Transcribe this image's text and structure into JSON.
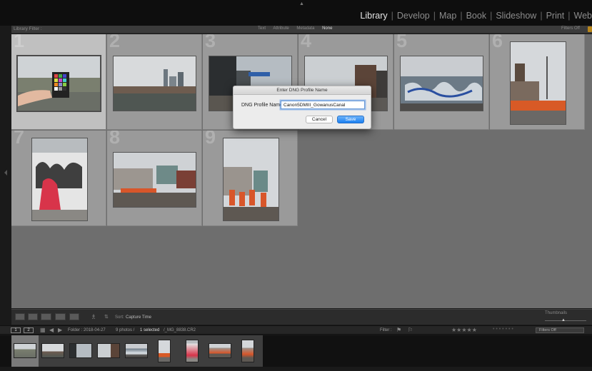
{
  "topbar": {
    "modules": [
      "Library",
      "Develop",
      "Map",
      "Book",
      "Slideshow",
      "Print",
      "Web"
    ],
    "active_module": "Library"
  },
  "filter_bar": {
    "title": "Library Filter :",
    "options": [
      "Text",
      "Attribute",
      "Metadata",
      "None"
    ],
    "active_option": "None",
    "filters_off_label": "Filters Off"
  },
  "grid": {
    "cells": [
      {
        "number": "1",
        "selected": true,
        "orientation": "landscape"
      },
      {
        "number": "2",
        "selected": false,
        "orientation": "landscape"
      },
      {
        "number": "3",
        "selected": false,
        "orientation": "landscape"
      },
      {
        "number": "4",
        "selected": false,
        "orientation": "landscape"
      },
      {
        "number": "5",
        "selected": false,
        "orientation": "landscape"
      },
      {
        "number": "6",
        "selected": false,
        "orientation": "portrait"
      },
      {
        "number": "7",
        "selected": false,
        "orientation": "portrait"
      },
      {
        "number": "8",
        "selected": false,
        "orientation": "landscape"
      },
      {
        "number": "9",
        "selected": false,
        "orientation": "portrait"
      }
    ]
  },
  "dialog": {
    "title": "Enter DNG Profile Name",
    "field_label": "DNG Profile Name",
    "field_value": "Canon5DMIII_GowanusCanal",
    "cancel_label": "Cancel",
    "save_label": "Save"
  },
  "toolbar": {
    "sort_label": "Sort:",
    "sort_value": "Capture Time",
    "thumbnails_label": "Thumbnails"
  },
  "statusbar": {
    "view_buttons": [
      "1",
      "2"
    ],
    "folder_text": "Folder : 2018-04-27",
    "photo_count": "9 photos /",
    "selected_count": "1 selected",
    "file_name": "/_MG_8838.CR2",
    "filter_label": "Filter :",
    "filters_off": "Filters Off"
  },
  "colors": {
    "accent_blue": "#1b7ff1",
    "dialog_bg": "#ececec",
    "grid_bg": "#6e6e6e",
    "cell_bg": "#9a9a9a",
    "cell_selected_bg": "#c0c0c0",
    "lock_icon": "#b8861b"
  },
  "icons": [
    "grid-view-icon",
    "loupe-view-icon",
    "compare-view-icon",
    "survey-view-icon",
    "people-view-icon",
    "painter-icon",
    "sort-direction-icon",
    "flag-filter-icon",
    "star-rating-icon",
    "lock-icon"
  ]
}
